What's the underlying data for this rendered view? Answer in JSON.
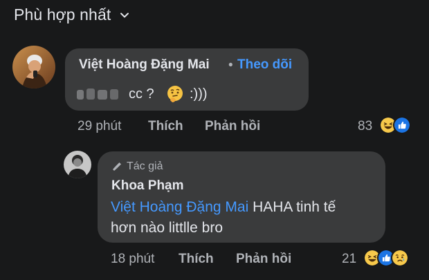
{
  "sort": {
    "label": "Phù hợp nhất"
  },
  "comment1": {
    "author": "Việt Hoàng Đặng Mai",
    "separator": "•",
    "follow_label": "Theo dõi",
    "text_before": "cc ?",
    "text_after": ":)))",
    "time": "29 phút",
    "like_label": "Thích",
    "reply_label": "Phản hồi",
    "reaction_count": "83",
    "reactions": [
      "haha-icon",
      "like-icon"
    ]
  },
  "comment2": {
    "badge": "Tác giả",
    "author": "Khoa Phạm",
    "mention": "Việt Hoàng Đặng Mai",
    "text_line1": "HAHA tinh tế",
    "text_line2": "hơn nào littlle bro",
    "time": "18 phút",
    "like_label": "Thích",
    "reply_label": "Phản hồi",
    "reaction_count": "21",
    "reactions": [
      "haha-icon",
      "like-icon",
      "sad-icon"
    ]
  },
  "colors": {
    "background": "#18191a",
    "bubble": "#3a3b3c",
    "link": "#4599ff",
    "secondary_text": "#b0b3b8",
    "primary_text": "#e4e6eb"
  }
}
